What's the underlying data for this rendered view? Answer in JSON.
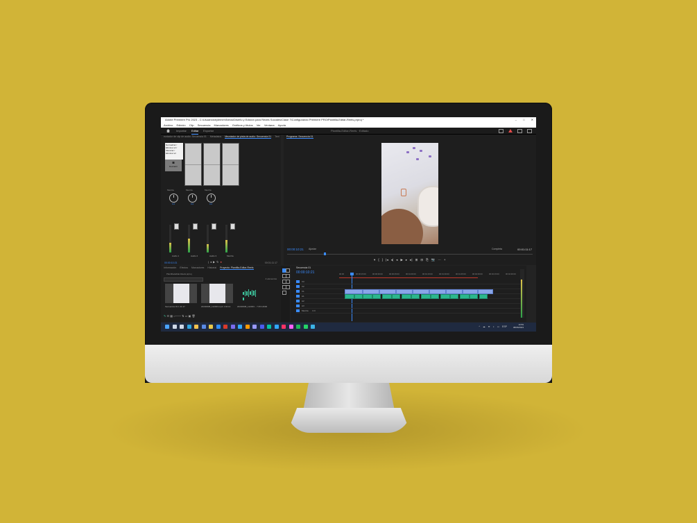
{
  "window": {
    "title": "Adobe Premiere Pro 2023 - C:\\Usuarios\\eyleme\\Videos\\Diseño y Edición para Redes Sociales\\Clase 7\\Configurando Premiere PRO\\Plantilla-Editar-Reels.prproj *",
    "controls": [
      "–",
      "□",
      "✕"
    ]
  },
  "menu": [
    "Archivo",
    "Edición",
    "Clip",
    "Secuencia",
    "Marcadores",
    "Gráficos y títulos",
    "Ver",
    "Ventana",
    "Ayuda"
  ],
  "workspace": {
    "tabs": [
      "Importar",
      "Editar",
      "Exportar"
    ],
    "active": "Editar",
    "center_title": "Plantilla-Editar-Reels",
    "center_sub": "Editado"
  },
  "mixer_panel": {
    "tabs": [
      "ezclador de clip de audio: Secuencia 01",
      "Metadatos",
      "Mezclador de pista de audio: Secuencia 01",
      "Text"
    ],
    "tooltip": "Normalizar / Eliminar sil / Silenciar / Eliminar sil",
    "disabled_label": "Deshabil.",
    "knob_label": "Mezcla",
    "knob_value": "0.0",
    "channels": [
      "Audio 1",
      "Audio 2",
      "Audio 3",
      "Mezcla"
    ],
    "meter_levels": [
      0.35,
      0.5,
      0.3,
      0.45
    ],
    "timecode_left": "00:00:10:21",
    "timecode_right": "00:01:11:17"
  },
  "program": {
    "tab": "Programa: Secuencia 01",
    "timecode": "00:00:10:21",
    "fit": "Ajustar",
    "quality": "Completa",
    "duration": "00:01:11:17",
    "playhead_fraction": 0.15,
    "controls": [
      "▾",
      "{",
      "}",
      "|◂",
      "◂|",
      "◂",
      "▶",
      "▸",
      "▸|",
      "⊞",
      "⊟",
      "⎘",
      "📷",
      "⋯",
      "+"
    ]
  },
  "project": {
    "tabs": [
      "Información",
      "Efectos",
      "Marcadores",
      "Historial",
      "Proyecto: Plantilla-Editar-Reels"
    ],
    "path": "Plantilla-Editar-Reels.prproj",
    "items_count": "4 elementos",
    "thumbnails": [
      {
        "label": "Secuencia 01",
        "duration": "1:11:17"
      },
      {
        "label": "20230608_112003.mp4",
        "duration": "1:04:14"
      },
      {
        "label": "20230608_112003...",
        "duration": "7:45:14600"
      }
    ]
  },
  "timeline": {
    "tab": "Secuencia 01",
    "timecode": "00:00:10:21",
    "ruler": [
      "00:00",
      "00:00:15:00",
      "00:00:30:00",
      "00:00:45:00",
      "00:01:00:00",
      "00:01:15:00",
      "00:01:30:00",
      "00:01:45:00",
      "00:02:00:00",
      "00:02:15:00",
      "00:02:30:00"
    ],
    "tracks": [
      {
        "name": "V3",
        "kind": "video"
      },
      {
        "name": "V2",
        "kind": "video"
      },
      {
        "name": "V1",
        "kind": "video"
      },
      {
        "name": "A1",
        "kind": "audio"
      },
      {
        "name": "A2",
        "kind": "audio"
      },
      {
        "name": "A3",
        "kind": "audio"
      },
      {
        "name": "Mezcla",
        "kind": "master",
        "value": "0.0"
      }
    ]
  },
  "taskbar": {
    "time": "10:59",
    "date": "08/06/2023",
    "lang": "ESP",
    "apps": [
      {
        "name": "start-icon",
        "color": "#4aa3ff"
      },
      {
        "name": "search-icon",
        "color": "#cfd8e6"
      },
      {
        "name": "taskview-icon",
        "color": "#cfd8e6"
      },
      {
        "name": "edge-icon",
        "color": "#2fa6e0"
      },
      {
        "name": "files-icon",
        "color": "#f2c14e"
      },
      {
        "name": "store-icon",
        "color": "#5a8ae6"
      },
      {
        "name": "chrome-icon",
        "color": "#e8c84a"
      },
      {
        "name": "zoom-icon",
        "color": "#2d8cff"
      },
      {
        "name": "acrobat-icon",
        "color": "#d93a2b"
      },
      {
        "name": "premiere-icon",
        "color": "#7b6cf0"
      },
      {
        "name": "photoshop-icon",
        "color": "#31a8ff"
      },
      {
        "name": "illustrator-icon",
        "color": "#ff9a00"
      },
      {
        "name": "aftereffects-icon",
        "color": "#9999ff"
      },
      {
        "name": "mediaencoder-icon",
        "color": "#4b5cf0"
      },
      {
        "name": "audition-icon",
        "color": "#00c4a3"
      },
      {
        "name": "lightroom-icon",
        "color": "#31a8ff"
      },
      {
        "name": "indesign-icon",
        "color": "#ff3366"
      },
      {
        "name": "xd-icon",
        "color": "#ff61f6"
      },
      {
        "name": "spotify-icon",
        "color": "#1db954"
      },
      {
        "name": "whatsapp-icon",
        "color": "#25d366"
      },
      {
        "name": "photos-icon",
        "color": "#3bb3e6"
      }
    ]
  }
}
